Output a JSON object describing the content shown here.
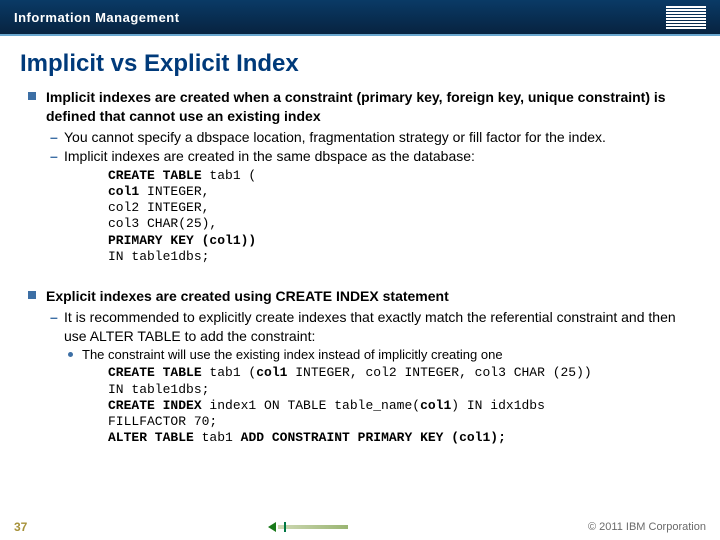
{
  "header": {
    "brand": "Information Management",
    "logo_name": "ibm-logo"
  },
  "title": "Implicit vs Explicit Index",
  "section1": {
    "main": "Implicit indexes are created when a constraint (primary key, foreign key, unique constraint) is defined that cannot use an existing index",
    "dash1": "You cannot specify a dbspace location, fragmentation strategy or fill factor for the index.",
    "dash2": "Implicit indexes are created in the same dbspace as the database:",
    "code": "CREATE TABLE tab1 (\ncol1 INTEGER,\ncol2 INTEGER,\ncol3 CHAR(25),\nPRIMARY KEY (col1))\nIN table1dbs;"
  },
  "section2": {
    "main": "Explicit indexes are created using CREATE INDEX statement",
    "dash1": "It is recommended to explicitly create indexes that exactly match the referential constraint and then use ALTER TABLE to add the constraint:",
    "dot1": "The constraint will use the existing index instead of implicitly creating one",
    "code": "CREATE TABLE tab1 (col1 INTEGER, col2 INTEGER, col3 CHAR (25))\nIN table1dbs;\nCREATE INDEX index1 ON TABLE table_name(col1) IN idx1dbs\nFILLFACTOR 70;\nALTER TABLE tab1 ADD CONSTRAINT PRIMARY KEY (col1);"
  },
  "footer": {
    "page": "37",
    "copyright": "© 2011 IBM Corporation"
  }
}
